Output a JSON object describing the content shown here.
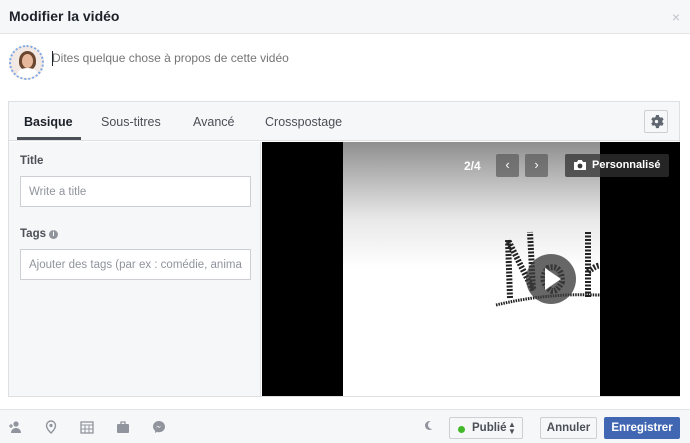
{
  "dialog": {
    "title": "Modifier la vidéo",
    "close_glyph": "×"
  },
  "composer": {
    "placeholder": "Dites quelque chose à propos de cette vidéo"
  },
  "tabs": [
    {
      "label": "Basique",
      "active": true
    },
    {
      "label": "Sous-titres",
      "active": false
    },
    {
      "label": "Avancé",
      "active": false
    },
    {
      "label": "Crosspostage",
      "active": false
    }
  ],
  "form": {
    "title_label": "Title",
    "title_placeholder": "Write a title",
    "tags_label": "Tags",
    "tags_info_glyph": "i",
    "tags_placeholder": "Ajouter des tags (par ex : comédie, animaux, c"
  },
  "preview": {
    "counter": "2/4",
    "prev_glyph": "‹",
    "next_glyph": "›",
    "custom_label": "Personnalisé"
  },
  "footer": {
    "icons": [
      "tag-people-icon",
      "location-pin-icon",
      "calendar-icon",
      "briefcase-icon",
      "messenger-icon"
    ],
    "privacy_label": "Publié",
    "privacy_arrows": "▲▼",
    "cancel_label": "Annuler",
    "save_label": "Enregistrer"
  },
  "colors": {
    "primary": "#4267b2",
    "status_published": "#42b72a",
    "border": "#dddfe2"
  }
}
